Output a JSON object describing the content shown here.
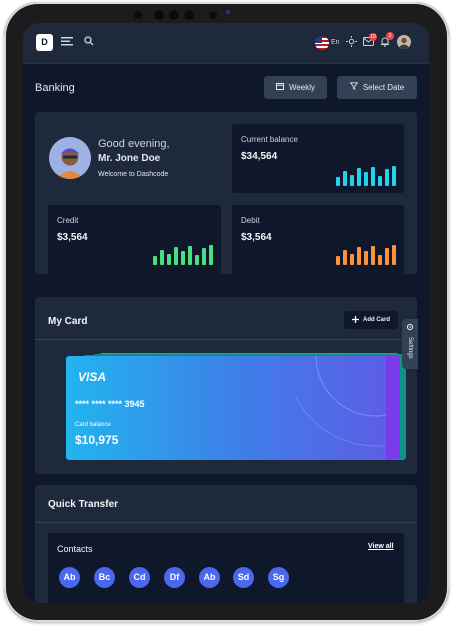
{
  "topbar": {
    "logo_text": "D",
    "language": "En",
    "mail_count": "10",
    "notification_count": "3"
  },
  "page": {
    "title": "Banking",
    "weekly_label": "Weekly",
    "select_date_label": "Select Date"
  },
  "greeting": {
    "line1": "Good evening,",
    "name": "Mr. Jone Doe",
    "welcome": "Welcome to Dashcode"
  },
  "stats": {
    "current_balance": {
      "label": "Current balance",
      "value": "$34,564",
      "bars": [
        0.45,
        0.75,
        0.55,
        0.9,
        0.7,
        0.95,
        0.5,
        0.85,
        1.0
      ],
      "color": "#22d3ee"
    },
    "credit": {
      "label": "Credit",
      "value": "$3,564",
      "bars": [
        0.45,
        0.75,
        0.55,
        0.9,
        0.7,
        0.95,
        0.5,
        0.85,
        1.0
      ],
      "color": "#4ade80"
    },
    "debit": {
      "label": "Debit",
      "value": "$3,564",
      "bars": [
        0.45,
        0.75,
        0.55,
        0.9,
        0.7,
        0.95,
        0.5,
        0.85,
        1.0
      ],
      "color": "#fb923c"
    }
  },
  "my_card": {
    "title": "My Card",
    "add_card_label": "Add Card",
    "settings_label": "Settings",
    "card": {
      "brand": "VISA",
      "number": "**** **** **** 3945",
      "balance_label": "Card balance",
      "balance": "$10,975"
    }
  },
  "quick_transfer": {
    "title": "Quick Transfer",
    "contacts_title": "Contacts",
    "view_all_label": "View all",
    "contacts": [
      "Ab",
      "Bc",
      "Cd",
      "Df",
      "Ab",
      "Sd",
      "Sg"
    ]
  },
  "colors": {
    "background": "#0f172a",
    "panel": "#1e293b",
    "accent_card": "#3f7ee8",
    "contact": "#4a67f0"
  }
}
